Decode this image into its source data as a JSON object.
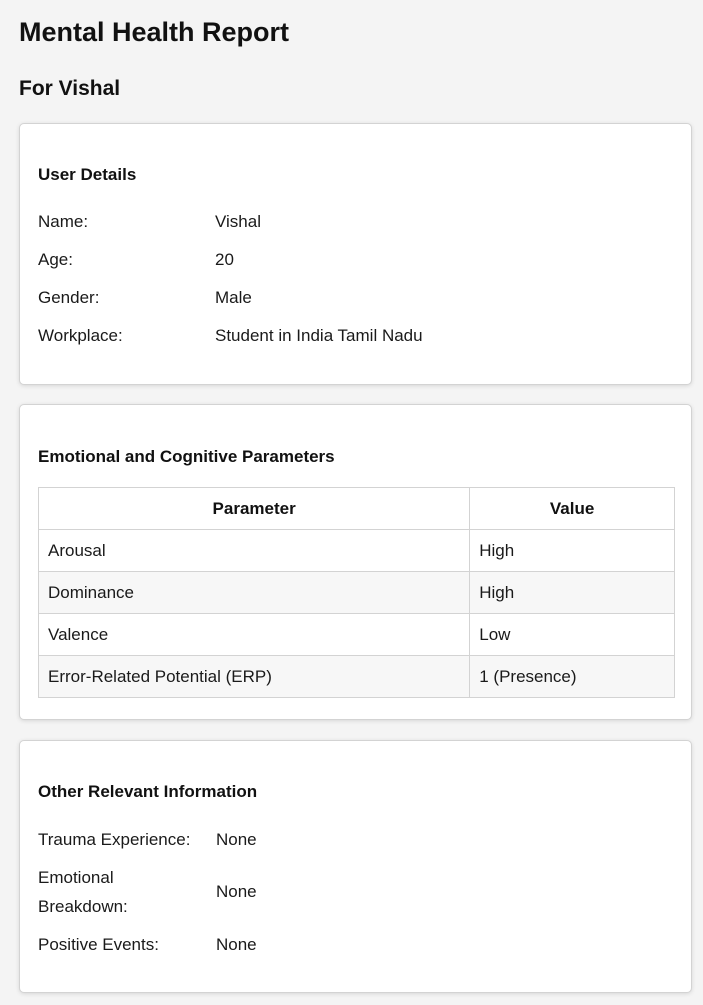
{
  "header": {
    "title": "Mental Health Report",
    "subtitle": "For Vishal"
  },
  "user_details": {
    "heading": "User Details",
    "rows": [
      {
        "label": "Name:",
        "value": "Vishal"
      },
      {
        "label": "Age:",
        "value": "20"
      },
      {
        "label": "Gender:",
        "value": "Male"
      },
      {
        "label": "Workplace:",
        "value": "Student in India Tamil Nadu"
      }
    ]
  },
  "parameters": {
    "heading": "Emotional and Cognitive Parameters",
    "columns": [
      "Parameter",
      "Value"
    ],
    "rows": [
      {
        "parameter": "Arousal",
        "value": "High"
      },
      {
        "parameter": "Dominance",
        "value": "High"
      },
      {
        "parameter": "Valence",
        "value": "Low"
      },
      {
        "parameter": "Error-Related Potential (ERP)",
        "value": "1 (Presence)"
      }
    ]
  },
  "other_info": {
    "heading": "Other Relevant Information",
    "rows": [
      {
        "label": "Trauma Experience:",
        "value": "None"
      },
      {
        "label_lines": [
          "Emotional",
          "Breakdown:"
        ],
        "value": "None"
      },
      {
        "label": "Positive Events:",
        "value": "None"
      }
    ]
  }
}
